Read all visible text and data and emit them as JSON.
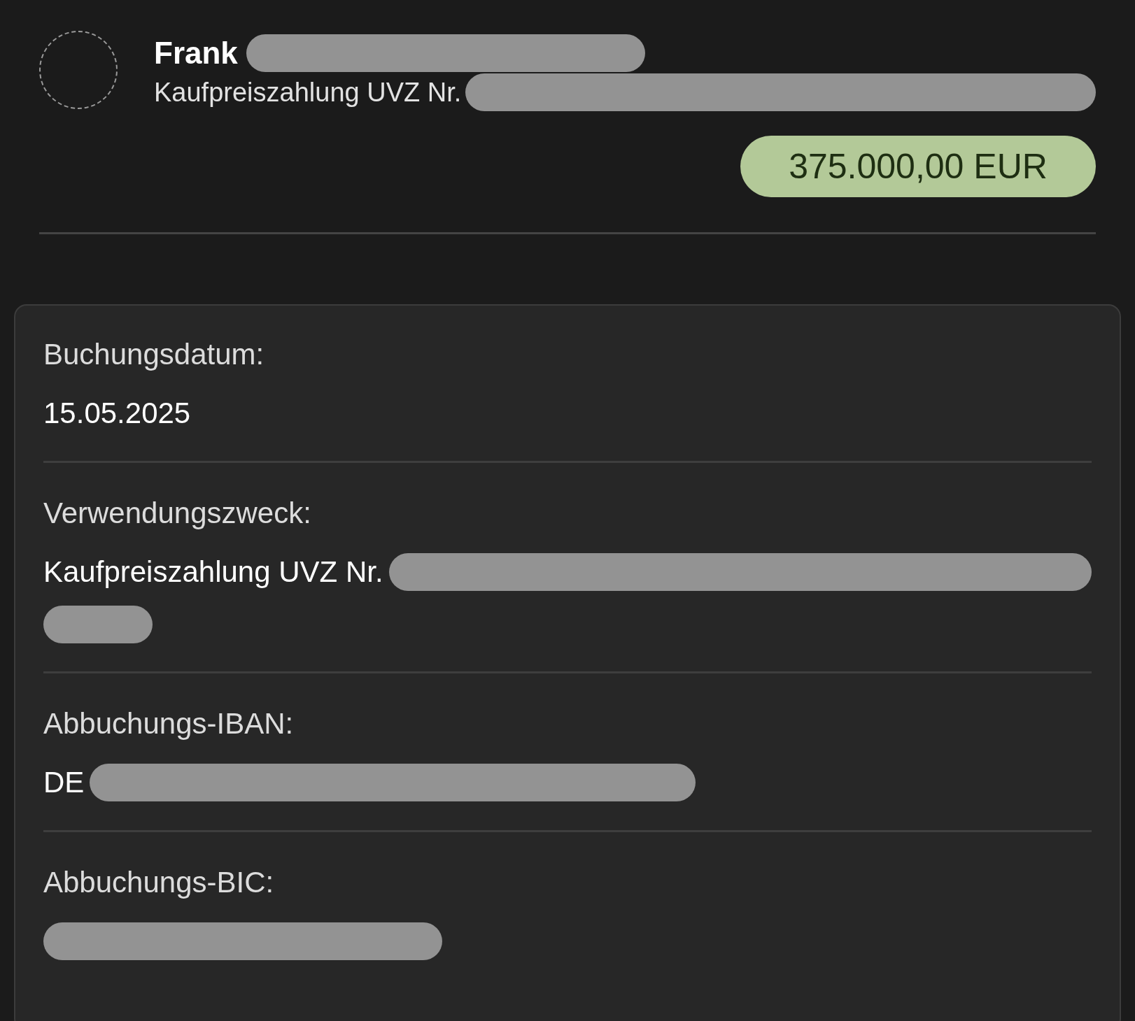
{
  "header": {
    "name": "Frank",
    "name_redacted": true,
    "subtitle": "Kaufpreiszahlung UVZ Nr.",
    "subtitle_redacted": true,
    "amount": "375.000,00 EUR"
  },
  "details": [
    {
      "label": "Buchungsdatum:",
      "value": "15.05.2025"
    },
    {
      "label": "Verwendungszweck:",
      "value": "Kaufpreiszahlung UVZ Nr.",
      "redacted": true
    },
    {
      "label": "Abbuchungs-IBAN:",
      "value": "DE",
      "redacted": true
    },
    {
      "label": "Abbuchungs-BIC:",
      "redacted": true
    }
  ]
}
